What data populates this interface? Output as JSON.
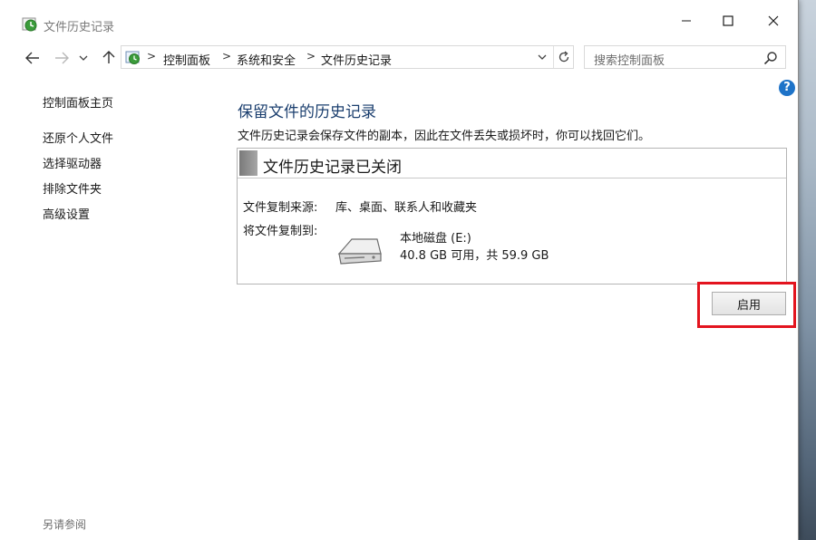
{
  "window": {
    "title": "文件历史记录"
  },
  "address": {
    "crumbs": [
      "控制面板",
      "系统和安全",
      "文件历史记录"
    ],
    "separator": ">"
  },
  "search": {
    "placeholder": "搜索控制面板"
  },
  "help": {
    "label": "?"
  },
  "sidebar": {
    "home": "控制面板主页",
    "items": [
      "还原个人文件",
      "选择驱动器",
      "排除文件夹",
      "高级设置"
    ],
    "see_also": "另请参阅"
  },
  "main": {
    "title": "保留文件的历史记录",
    "description": "文件历史记录会保存文件的副本，因此在文件丢失或损坏时，你可以找回它们。",
    "panel": {
      "status": "文件历史记录已关闭",
      "copy_from_label": "文件复制来源:",
      "copy_from_value": "库、桌面、联系人和收藏夹",
      "copy_to_label": "将文件复制到:",
      "drive_name": "本地磁盘 (E:)",
      "drive_size": "40.8 GB 可用，共 59.9 GB"
    },
    "enable_button": "启用"
  },
  "colors": {
    "highlight": "#e3141e",
    "title_blue": "#1a3e6e",
    "help_blue": "#1e73c8"
  }
}
